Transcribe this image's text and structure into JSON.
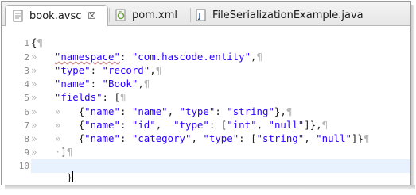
{
  "tabs": [
    {
      "label": "book.avsc",
      "close": "☒",
      "active": true,
      "icon": "avsc-file-icon"
    },
    {
      "label": "pom.xml",
      "active": false,
      "icon": "maven-xml-icon"
    },
    {
      "label": "FileSerializationExample.java",
      "active": false,
      "icon": "java-file-icon"
    }
  ],
  "editor": {
    "line_numbers": [
      "1",
      "2",
      "3",
      "4",
      "5",
      "6",
      "7",
      "8",
      "9",
      "10"
    ],
    "lines": [
      "{¶",
      "»   \"namespace\": \"com.hascode.entity\",¶",
      "»   \"type\": \"record\",¶",
      "»   \"name\": \"Book\",¶",
      "»   \"fields\": [¶",
      "»   »   {\"name\": \"name\", \"type\": \"string\"},¶",
      "»   »   {\"name\": \"id\",  \"type\": [\"int\", \"null\"]},¶",
      "»   »   {\"name\": \"category\", \"type\": [\"string\", \"null\"]}¶",
      "»   ·]¶",
      "}"
    ]
  },
  "colors": {
    "string": "#2a00ff",
    "whitespace_marker": "#b6b6b6",
    "current_line": "#e8f2fe"
  }
}
